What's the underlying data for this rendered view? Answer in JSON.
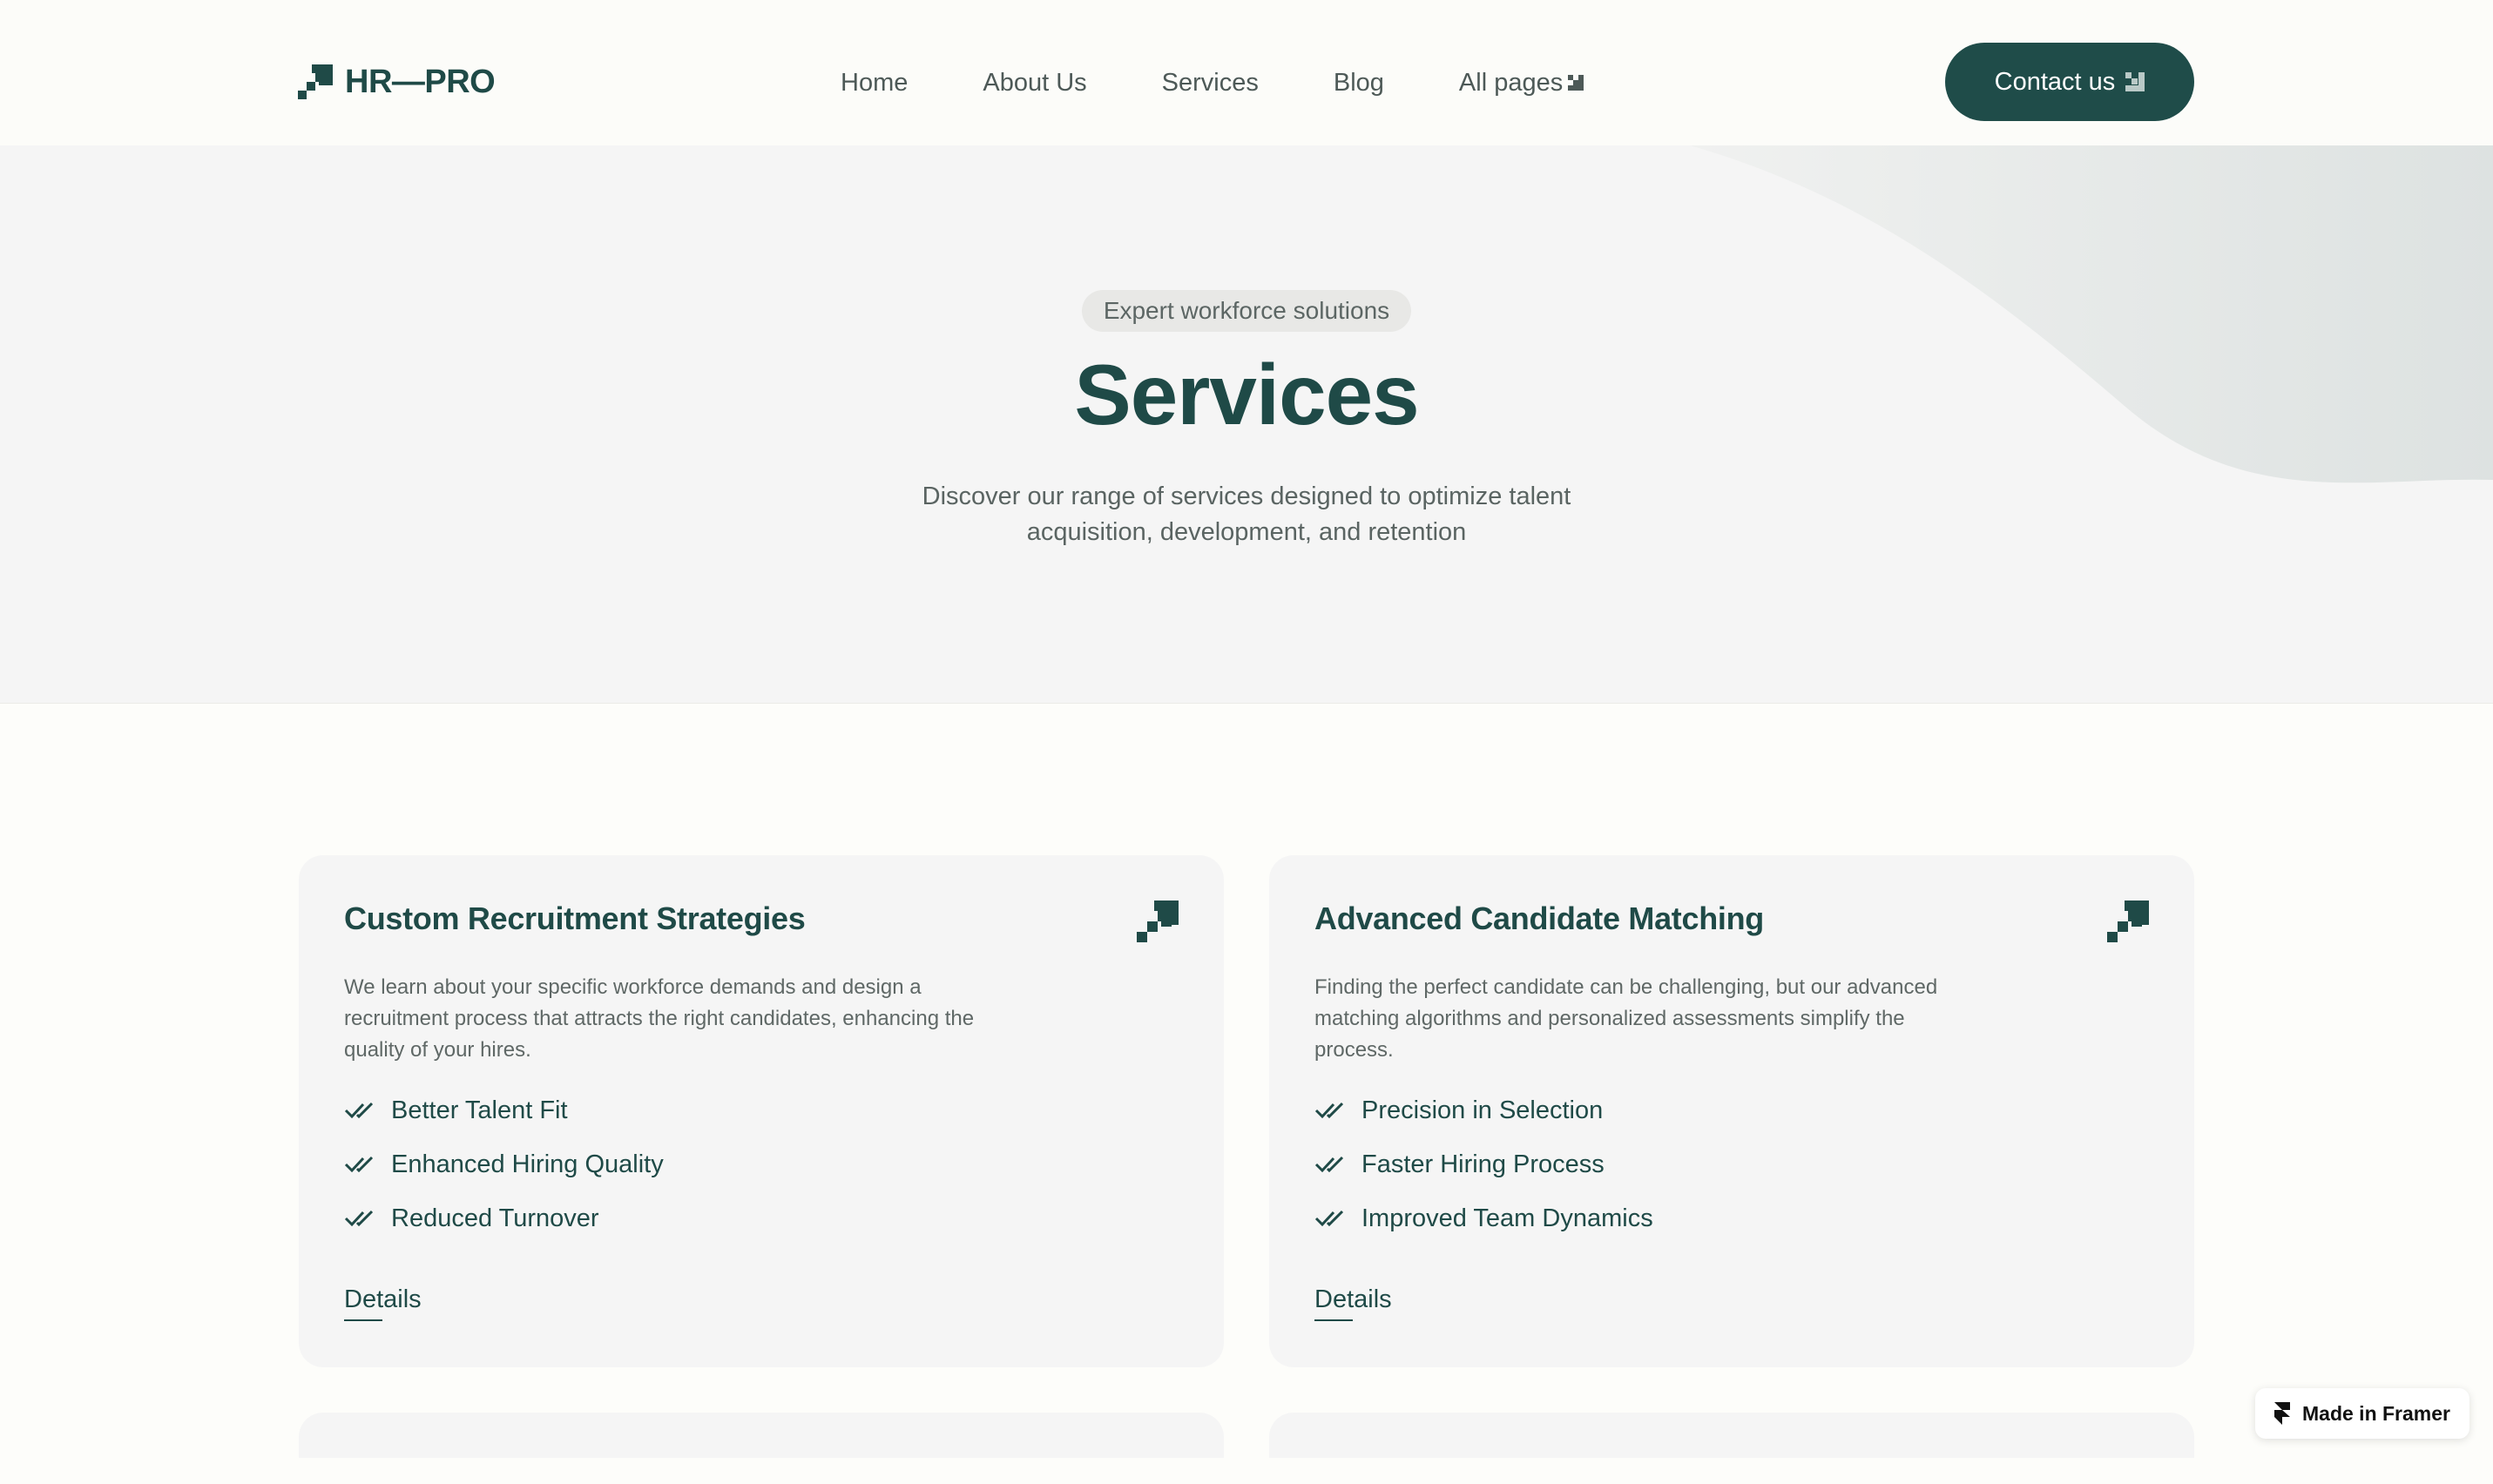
{
  "header": {
    "logo_text": "HR—PRO",
    "logo_icon": "stairs-logo-icon",
    "nav": [
      {
        "label": "Home"
      },
      {
        "label": "About Us"
      },
      {
        "label": "Services"
      },
      {
        "label": "Blog"
      },
      {
        "label": "All pages",
        "icon": "arrow-down-right-icon"
      }
    ],
    "contact_label": "Contact us",
    "contact_icon": "arrow-down-right-icon"
  },
  "hero": {
    "badge": "Expert workforce solutions",
    "title": "Services",
    "subtitle": "Discover our range of services designed to optimize talent acquisition, development, and retention"
  },
  "cards": [
    {
      "title": "Custom Recruitment Strategies",
      "icon": "stairs-icon",
      "description": "We learn about your specific workforce demands and design a recruitment process that attracts the right candidates, enhancing the quality of your hires.",
      "features": [
        "Better Talent Fit",
        "Enhanced Hiring Quality",
        "Reduced Turnover"
      ],
      "feature_icon": "double-check-icon",
      "link": "Details"
    },
    {
      "title": "Advanced Candidate Matching",
      "icon": "stairs-icon",
      "description": "Finding the perfect candidate can be challenging, but our advanced matching algorithms and personalized assessments simplify the process.",
      "features": [
        "Precision in Selection",
        "Faster Hiring Process",
        "Improved Team Dynamics"
      ],
      "feature_icon": "double-check-icon",
      "link": "Details"
    }
  ],
  "framer_badge": {
    "label": "Made in Framer",
    "icon": "framer-icon"
  },
  "colors": {
    "brand": "#1f4c49",
    "page_background": "#fdfdfa",
    "hero_background": "#f5f5f5",
    "card_background": "#f5f5f5",
    "text_muted": "#5f6866"
  }
}
